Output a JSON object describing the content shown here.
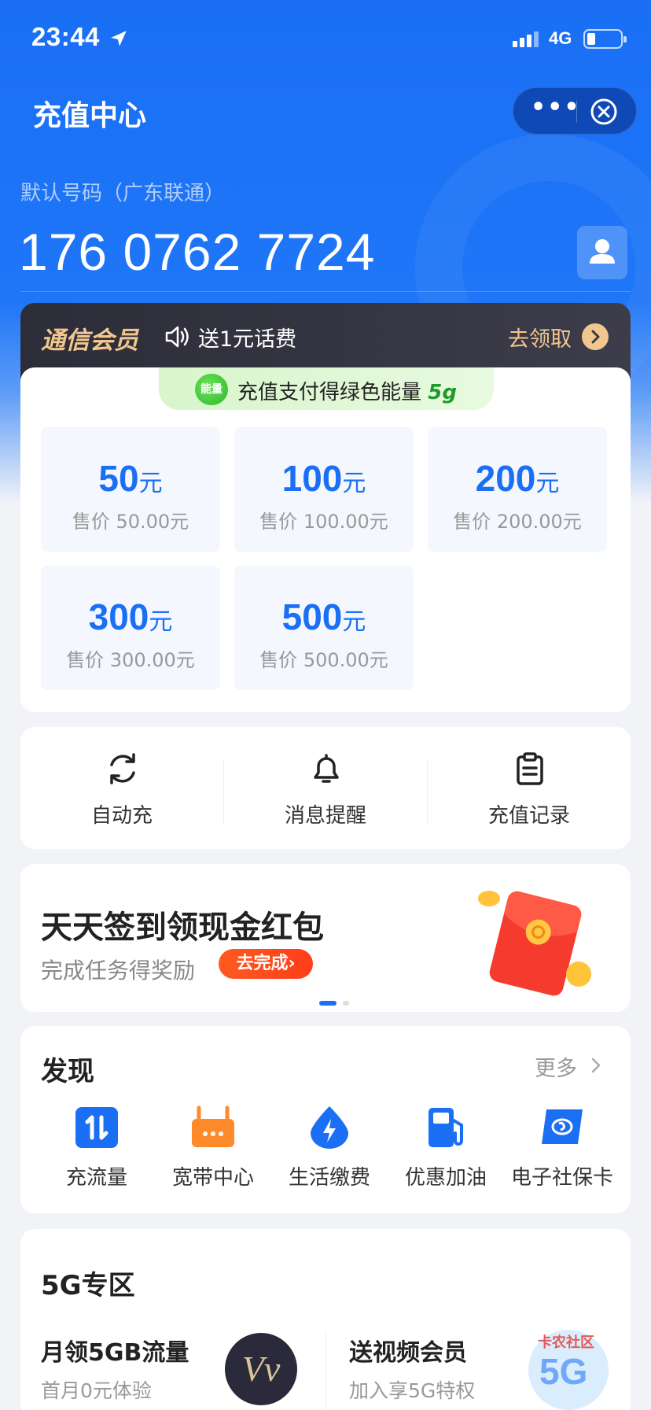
{
  "status_bar": {
    "time": "23:44",
    "network": "4G"
  },
  "nav": {
    "title": "充值中心",
    "more_label": "•••"
  },
  "account": {
    "label": "默认号码（广东联通）",
    "phone_number": "176 0762 7724"
  },
  "member": {
    "title": "通信会员",
    "gift": "送1元话费",
    "claim": "去领取"
  },
  "energy": {
    "text": "充值支付得绿色能量",
    "amount": "5g",
    "icon_text": "能量"
  },
  "recharge_options": [
    {
      "amount": "50",
      "unit": "元",
      "price": "售价 50.00元"
    },
    {
      "amount": "100",
      "unit": "元",
      "price": "售价 100.00元"
    },
    {
      "amount": "200",
      "unit": "元",
      "price": "售价 200.00元"
    },
    {
      "amount": "300",
      "unit": "元",
      "price": "售价 300.00元"
    },
    {
      "amount": "500",
      "unit": "元",
      "price": "售价 500.00元"
    }
  ],
  "tools": [
    {
      "label": "自动充",
      "icon": "refresh-icon"
    },
    {
      "label": "消息提醒",
      "icon": "bell-icon"
    },
    {
      "label": "充值记录",
      "icon": "clipboard-icon"
    }
  ],
  "banner": {
    "title": "天天签到领现金红包",
    "subtitle": "完成任务得奖励",
    "button": "去完成",
    "button_arrow": "›"
  },
  "discover": {
    "title": "发现",
    "more": "更多",
    "services": [
      {
        "label": "充流量",
        "icon": "data-traffic-icon",
        "color": "#1a6ff5"
      },
      {
        "label": "宽带中心",
        "icon": "router-icon",
        "color": "#ff8a2a"
      },
      {
        "label": "生活缴费",
        "icon": "utility-drop-icon",
        "color": "#1a6ff5"
      },
      {
        "label": "优惠加油",
        "icon": "fuel-pump-icon",
        "color": "#1a6ff5"
      },
      {
        "label": "电子社保卡",
        "icon": "social-security-card-icon",
        "color": "#1a6ff5"
      }
    ]
  },
  "fiveg": {
    "title": "5G专区",
    "items": [
      {
        "title": "月领5GB流量",
        "subtitle": "首月0元体验",
        "logo_text": "Vv"
      },
      {
        "title": "送视频会员",
        "subtitle": "加入享5G特权"
      }
    ]
  },
  "watermark": {
    "text": "卡农社区",
    "badge": "5G"
  },
  "colors": {
    "primary": "#1a6ff5",
    "gold": "#f2c78e",
    "orange": "#ff5a1f"
  }
}
